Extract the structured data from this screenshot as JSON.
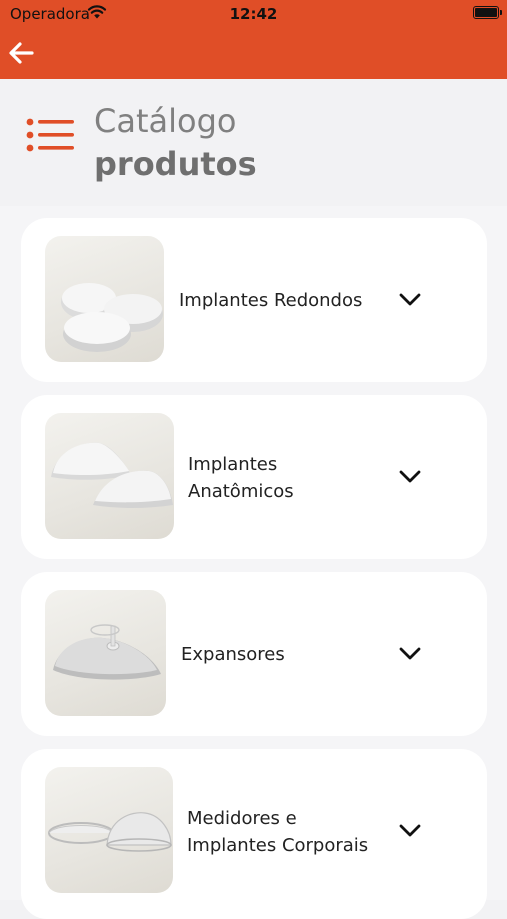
{
  "status_bar": {
    "carrier": "Operadora",
    "time": "12:42"
  },
  "header": {
    "title_line1": "Catálogo",
    "title_line2": "produtos"
  },
  "categories": [
    {
      "label_line1": "Implantes Redondos",
      "label_line2": ""
    },
    {
      "label_line1": "Implantes",
      "label_line2": "Anatômicos"
    },
    {
      "label_line1": "Expansores",
      "label_line2": ""
    },
    {
      "label_line1": "Medidores e",
      "label_line2": "Implantes Corporais"
    }
  ],
  "colors": {
    "brand": "#e04e27",
    "background": "#f2f2f4",
    "card": "#ffffff"
  },
  "icons": {
    "back": "arrow-left-icon",
    "menu": "list-menu-icon",
    "expand": "chevron-down-icon"
  }
}
